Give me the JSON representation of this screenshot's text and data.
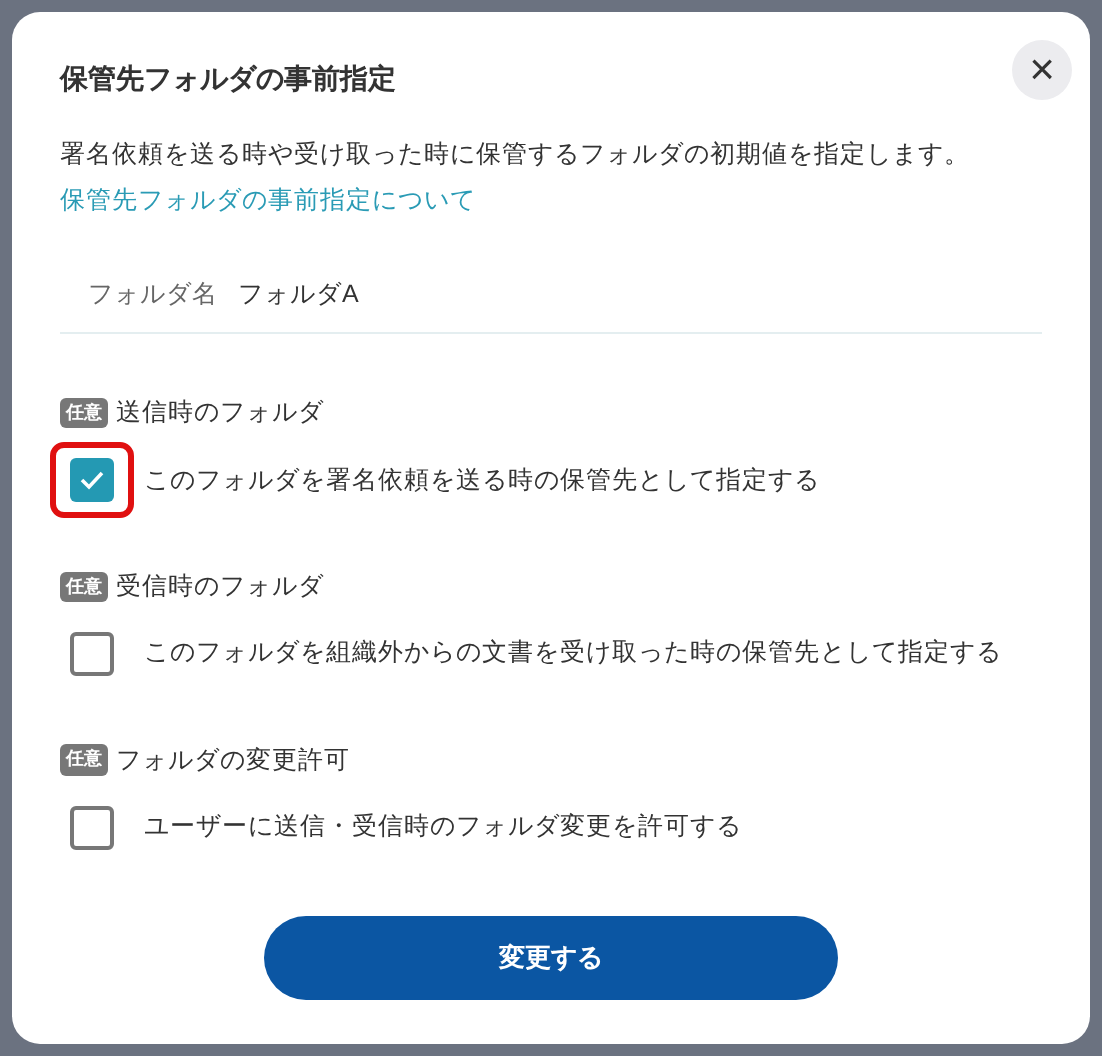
{
  "dialog": {
    "title": "保管先フォルダの事前指定",
    "close": "×",
    "description": "署名依頼を送る時や受け取った時に保管するフォルダの初期値を指定します。",
    "help_link": "保管先フォルダの事前指定について",
    "folder": {
      "label": "フォルダ名",
      "value": "フォルダA"
    },
    "sections": [
      {
        "badge": "任意",
        "title": "送信時のフォルダ",
        "option": "このフォルダを署名依頼を送る時の保管先として指定する",
        "checked": true,
        "highlighted": true
      },
      {
        "badge": "任意",
        "title": "受信時のフォルダ",
        "option": "このフォルダを組織外からの文書を受け取った時の保管先として指定する",
        "checked": false,
        "highlighted": false
      },
      {
        "badge": "任意",
        "title": "フォルダの変更許可",
        "option": "ユーザーに送信・受信時のフォルダ変更を許可する",
        "checked": false,
        "highlighted": false
      }
    ],
    "submit": "変更する"
  }
}
